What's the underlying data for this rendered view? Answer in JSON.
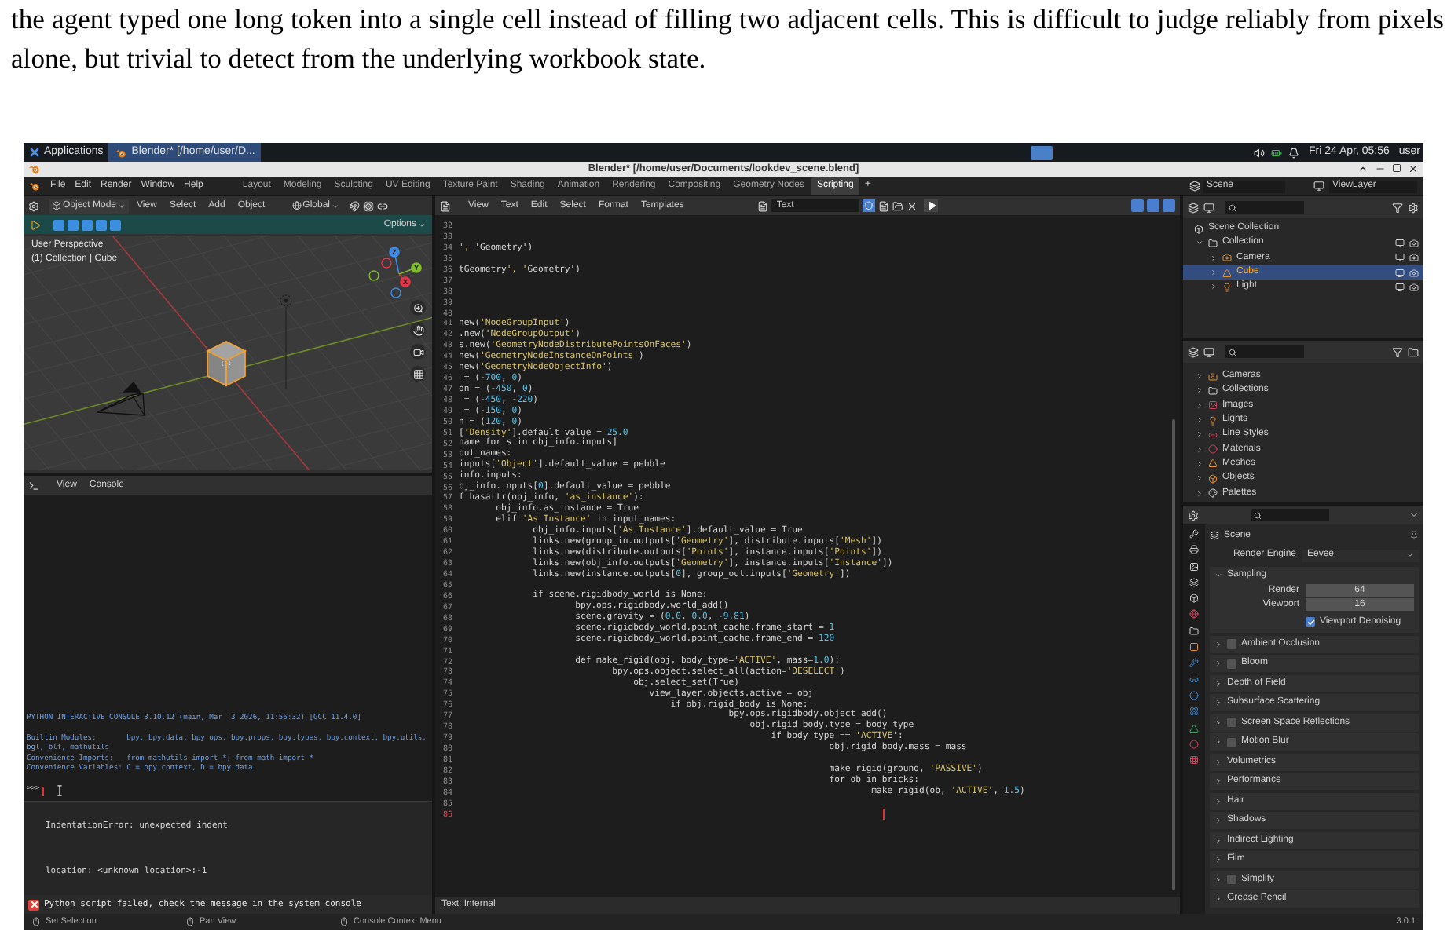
{
  "caption": "the agent typed one long token into a single cell instead of filling two adjacent cells. This is difficult to judge reliably from pixels alone, but trivial to detect from the underlying workbook state.",
  "taskbar": {
    "apps_menu": "Applications",
    "window_tab": "Blender* [/home/user/D...",
    "clock": "Fri 24 Apr, 05:56",
    "user": "user"
  },
  "title_bar": {
    "title": "Blender* [/home/user/Documents/lookdev_scene.blend]"
  },
  "menu": [
    "File",
    "Edit",
    "Render",
    "Window",
    "Help"
  ],
  "workspaces": [
    {
      "label": "Layout",
      "selected": false
    },
    {
      "label": "Modeling",
      "selected": false
    },
    {
      "label": "Sculpting",
      "selected": false
    },
    {
      "label": "UV Editing",
      "selected": false
    },
    {
      "label": "Texture Paint",
      "selected": false
    },
    {
      "label": "Shading",
      "selected": false
    },
    {
      "label": "Animation",
      "selected": false
    },
    {
      "label": "Rendering",
      "selected": false
    },
    {
      "label": "Compositing",
      "selected": false
    },
    {
      "label": "Geometry Nodes",
      "selected": false
    },
    {
      "label": "Scripting",
      "selected": true
    }
  ],
  "add_workspace": "+",
  "scene_field": "Scene",
  "view_layer_field": "ViewLayer",
  "viewport": {
    "mode": "Object Mode",
    "menu": [
      "View",
      "Select",
      "Add",
      "Object"
    ],
    "orientation": "Global",
    "options": "Options",
    "overlay_lines": [
      "User Perspective",
      "(1) Collection | Cube"
    ],
    "gizmo_axes": [
      "Z",
      "Y",
      "X"
    ]
  },
  "console": {
    "menu": [
      "View",
      "Console"
    ],
    "output": [
      "PYTHON INTERACTIVE CONSOLE 3.10.12 (main, Mar  3 2026, 11:56:32) [GCC 11.4.0]",
      "Builtin Modules:       bpy, bpy.data, bpy.ops, bpy.props, bpy.types, bpy.context, bpy.utils, bgl, blf, mathutils",
      "Convenience Imports:   from mathutils import *; from math import *",
      "Convenience Variables: C = bpy.context, D = bpy.data"
    ],
    "prompt": ">>>",
    "info": [
      "IndentationError: unexpected indent",
      "location: <unknown location>:-1"
    ],
    "error": "Python script failed, check the message in the system console"
  },
  "text_editor": {
    "menu": [
      "View",
      "Text",
      "Edit",
      "Select",
      "Format",
      "Templates"
    ],
    "text_block": "Text",
    "footer": "Text: Internal",
    "lines": [
      {
        "number": "32",
        "current": false
      },
      {
        "number": "33",
        "current": false
      },
      {
        "number": "34",
        "code": "', 'Geometry')",
        "current": false
      },
      {
        "number": "35",
        "current": false
      },
      {
        "number": "36",
        "code": "tGeometry', 'Geometry')",
        "current": false
      },
      {
        "number": "37",
        "current": false
      },
      {
        "number": "38",
        "current": false
      },
      {
        "number": "39",
        "current": false
      },
      {
        "number": "40",
        "current": false
      },
      {
        "number": "41",
        "code": "new('NodeGroupInput')",
        "current": false
      },
      {
        "number": "42",
        "code": ".new('NodeGroupOutput')",
        "current": false
      },
      {
        "number": "43",
        "code": "s.new('GeometryNodeDistributePointsOnFaces')",
        "current": false
      },
      {
        "number": "44",
        "code": "new('GeometryNodeInstanceOnPoints')",
        "current": false
      },
      {
        "number": "45",
        "code": "new('GeometryNodeObjectInfo')",
        "current": false
      },
      {
        "number": "46",
        "code": " = (-700, 0)",
        "current": false
      },
      {
        "number": "47",
        "code": "on = (-450, 0)",
        "current": false
      },
      {
        "number": "48",
        "code": " = (-450, -220)",
        "current": false
      },
      {
        "number": "49",
        "code": " = (-150, 0)",
        "current": false
      },
      {
        "number": "50",
        "code": "n = (120, 0)",
        "current": false
      },
      {
        "number": "51",
        "code": "['Density'].default_value = 25.0",
        "current": false
      },
      {
        "number": "52",
        "code": "name for s in obj_info.inputs]",
        "current": false
      },
      {
        "number": "53",
        "code": "put_names:",
        "current": false
      },
      {
        "number": "54",
        "code": "inputs['Object'].default_value = pebble",
        "current": false
      },
      {
        "number": "55",
        "code": "info.inputs:",
        "current": false
      },
      {
        "number": "56",
        "code": "bj_info.inputs[0].default_value = pebble",
        "current": false
      },
      {
        "number": "57",
        "code": "f hasattr(obj_info, 'as_instance'):",
        "current": false
      },
      {
        "number": "58",
        "code": "       obj_info.as_instance = True",
        "current": false
      },
      {
        "number": "59",
        "code": "       elif 'As Instance' in input_names:",
        "current": false
      },
      {
        "number": "60",
        "code": "              obj_info.inputs['As Instance'].default_value = True",
        "current": false
      },
      {
        "number": "61",
        "code": "              links.new(group_in.outputs['Geometry'], distribute.inputs['Mesh'])",
        "current": false
      },
      {
        "number": "62",
        "code": "              links.new(distribute.outputs['Points'], instance.inputs['Points'])",
        "current": false
      },
      {
        "number": "63",
        "code": "              links.new(obj_info.outputs['Geometry'], instance.inputs['Instance'])",
        "current": false
      },
      {
        "number": "64",
        "code": "              links.new(instance.outputs[0], group_out.inputs['Geometry'])",
        "current": false
      },
      {
        "number": "65",
        "current": false
      },
      {
        "number": "66",
        "code": "              if scene.rigidbody_world is None:",
        "current": false
      },
      {
        "number": "67",
        "code": "                      bpy.ops.rigidbody.world_add()",
        "current": false
      },
      {
        "number": "68",
        "code": "                      scene.gravity = (0.0, 0.0, -9.81)",
        "current": false
      },
      {
        "number": "69",
        "code": "                      scene.rigidbody_world.point_cache.frame_start = 1",
        "current": false
      },
      {
        "number": "70",
        "code": "                      scene.rigidbody_world.point_cache.frame_end = 120",
        "current": false
      },
      {
        "number": "71",
        "current": false
      },
      {
        "number": "72",
        "code": "                      def make_rigid(obj, body_type='ACTIVE', mass=1.0):",
        "current": false
      },
      {
        "number": "73",
        "code": "                             bpy.ops.object.select_all(action='DESELECT')",
        "current": false
      },
      {
        "number": "74",
        "code": "                                 obj.select_set(True)",
        "current": false
      },
      {
        "number": "75",
        "code": "                                    view_layer.objects.active = obj",
        "current": false
      },
      {
        "number": "76",
        "code": "                                        if obj.rigid_body is None:",
        "current": false
      },
      {
        "number": "77",
        "code": "                                                   bpy.ops.rigidbody.object_add()",
        "current": false
      },
      {
        "number": "78",
        "code": "                                                       obj.rigid_body.type = body_type",
        "current": false
      },
      {
        "number": "79",
        "code": "                                                           if body_type == 'ACTIVE':",
        "current": false
      },
      {
        "number": "80",
        "code": "                                                                      obj.rigid_body.mass = mass",
        "current": false
      },
      {
        "number": "81",
        "current": false
      },
      {
        "number": "82",
        "code": "                                                                      make_rigid(ground, 'PASSIVE')",
        "current": false
      },
      {
        "number": "83",
        "code": "                                                                      for ob in bricks:",
        "current": false
      },
      {
        "number": "84",
        "code": "                                                                              make_rigid(ob, 'ACTIVE', 1.5)",
        "current": false
      },
      {
        "number": "85",
        "current": false
      },
      {
        "number": "86",
        "current": true
      }
    ]
  },
  "outliner": {
    "items": [
      {
        "label": "Scene Collection",
        "kind": "scene",
        "selected": false,
        "children": [
          {
            "label": "Collection",
            "kind": "collection",
            "selected": false,
            "expanded": true,
            "children": [
              {
                "label": "Camera",
                "kind": "camera",
                "selected": false,
                "expanded": false
              },
              {
                "label": "Cube",
                "kind": "mesh",
                "selected": true,
                "expanded": false
              },
              {
                "label": "Light",
                "kind": "light",
                "selected": false,
                "expanded": false
              }
            ]
          }
        ]
      }
    ]
  },
  "data_outliner": {
    "items": [
      {
        "label": "Cameras",
        "kind": "camera",
        "expanded": false
      },
      {
        "label": "Collections",
        "kind": "collection",
        "expanded": false
      },
      {
        "label": "Images",
        "kind": "image",
        "expanded": false
      },
      {
        "label": "Lights",
        "kind": "light",
        "expanded": false
      },
      {
        "label": "Line Styles",
        "kind": "linestyle",
        "expanded": false
      },
      {
        "label": "Materials",
        "kind": "material",
        "expanded": false
      },
      {
        "label": "Meshes",
        "kind": "mesh",
        "expanded": false
      },
      {
        "label": "Objects",
        "kind": "object",
        "expanded": false
      },
      {
        "label": "Palettes",
        "kind": "palette",
        "expanded": false
      }
    ]
  },
  "properties": {
    "context": "Scene",
    "render_engine_label": "Render Engine",
    "render_engine": "Eevee",
    "panels": [
      {
        "label": "Sampling",
        "kind": "plain",
        "expanded": true,
        "fields": [
          {
            "label": "Render",
            "value": "64"
          },
          {
            "label": "Viewport",
            "value": "16"
          }
        ],
        "options": [
          {
            "label": "Viewport Denoising",
            "checked": true
          }
        ]
      },
      {
        "label": "Ambient Occlusion",
        "kind": "toggle",
        "checked": false,
        "expanded": false
      },
      {
        "label": "Bloom",
        "kind": "toggle",
        "checked": false,
        "expanded": false
      },
      {
        "label": "Depth of Field",
        "kind": "plain",
        "expanded": false
      },
      {
        "label": "Subsurface Scattering",
        "kind": "plain",
        "expanded": false
      },
      {
        "label": "Screen Space Reflections",
        "kind": "toggle",
        "checked": false,
        "expanded": false
      },
      {
        "label": "Motion Blur",
        "kind": "toggle",
        "checked": false,
        "expanded": false
      },
      {
        "label": "Volumetrics",
        "kind": "plain",
        "expanded": false
      },
      {
        "label": "Performance",
        "kind": "plain",
        "expanded": false
      },
      {
        "label": "Hair",
        "kind": "plain",
        "expanded": false
      },
      {
        "label": "Shadows",
        "kind": "plain",
        "expanded": false
      },
      {
        "label": "Indirect Lighting",
        "kind": "plain",
        "expanded": false
      },
      {
        "label": "Film",
        "kind": "plain",
        "expanded": false
      },
      {
        "label": "Simplify",
        "kind": "toggle",
        "checked": false,
        "expanded": false
      },
      {
        "label": "Grease Pencil",
        "kind": "plain",
        "expanded": false
      }
    ]
  },
  "status_bar": {
    "hints": [
      "Set Selection",
      "Pan View",
      "Console Context Menu"
    ],
    "version": "3.0.1"
  }
}
